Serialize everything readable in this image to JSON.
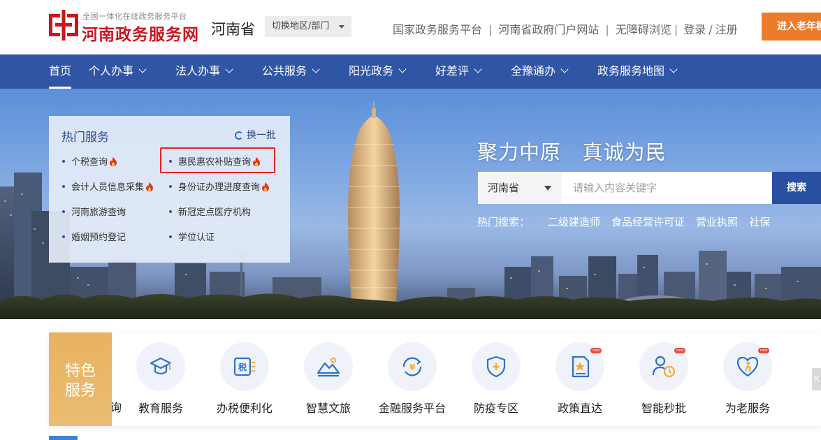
{
  "header": {
    "logo_small": "全国一体化在线政务服务平台",
    "logo_title": "河南政务服务网",
    "province": "河南省",
    "switch_region": "切换地区/部门",
    "links": [
      "国家政务服务平台",
      "河南省政府门户网站",
      "无障碍浏览"
    ],
    "login": "登录",
    "register": "注册",
    "elder_mode": "进入老年模式",
    "brand_color": "#c8161d",
    "accent_color": "#ec7c2b"
  },
  "nav": {
    "bg_color": "#2f55a4",
    "items": [
      {
        "label": "首页"
      },
      {
        "label": "个人办事"
      },
      {
        "label": "法人办事"
      },
      {
        "label": "公共服务"
      },
      {
        "label": "阳光政务"
      },
      {
        "label": "好差评"
      },
      {
        "label": "全豫通办"
      },
      {
        "label": "政务服务地图"
      }
    ]
  },
  "hot_services": {
    "title": "热门服务",
    "refresh": "换一批",
    "items": [
      {
        "label": "个税查询",
        "hot": true
      },
      {
        "label": "惠民惠农补贴查询",
        "hot": true
      },
      {
        "label": "会计人员信息采集",
        "hot": true
      },
      {
        "label": "身份证办理进度查询",
        "hot": true
      },
      {
        "label": "河南旅游查询",
        "hot": false
      },
      {
        "label": "新冠定点医疗机构",
        "hot": false
      },
      {
        "label": "婚姻预约登记",
        "hot": false
      },
      {
        "label": "学位认证",
        "hot": false
      }
    ]
  },
  "hero": {
    "slogan": "聚力中原   真诚为民",
    "search_region": "河南省",
    "search_placeholder": "请输入内容关键字",
    "search_button": "搜索",
    "hot_search_label": "热门搜索：",
    "hot_keywords": [
      "二级建造师",
      "食品经营许可证",
      "营业执照",
      "社保"
    ]
  },
  "features": {
    "tag_line1": "特色",
    "tag_line2": "服务",
    "partial_label": "询",
    "items": [
      {
        "label": "教育服务",
        "icon": "graduation-cap-icon",
        "new": false
      },
      {
        "label": "办税便利化",
        "icon": "tax-icon",
        "new": false
      },
      {
        "label": "智慧文旅",
        "icon": "mountain-icon",
        "new": false
      },
      {
        "label": "金融服务平台",
        "icon": "yuan-exchange-icon",
        "new": false
      },
      {
        "label": "防疫专区",
        "icon": "shield-plus-icon",
        "new": false
      },
      {
        "label": "政策直达",
        "icon": "document-star-icon",
        "new": true
      },
      {
        "label": "智能秒批",
        "icon": "person-clock-icon",
        "new": true
      },
      {
        "label": "为老服务",
        "icon": "heart-elder-icon",
        "new": true
      }
    ],
    "new_badge": "new",
    "close_glyph": "×"
  }
}
